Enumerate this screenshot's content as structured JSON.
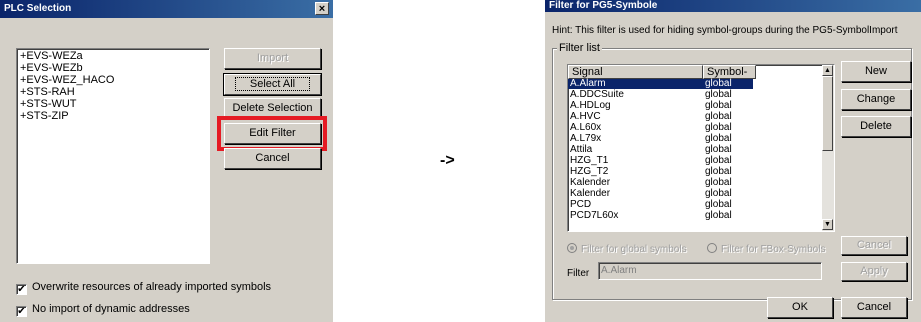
{
  "plc_dialog": {
    "title": "PLC Selection",
    "close_glyph": "×",
    "list_items": [
      "+EVS-WEZa",
      "+EVS-WEZb",
      "+EVS-WEZ_HACO",
      "+STS-RAH",
      "+STS-WUT",
      "+STS-ZIP"
    ],
    "buttons": {
      "import": "Import",
      "select_all": "Select All",
      "delete_selection": "Delete Selection",
      "edit_filter": "Edit Filter",
      "cancel": "Cancel"
    },
    "checkboxes": [
      {
        "label": "Overwrite resources of already imported symbols",
        "checked": true
      },
      {
        "label": "No import of dynamic addresses",
        "checked": true
      }
    ],
    "check_glyph": "✔"
  },
  "arrow": "->",
  "filter_dialog": {
    "title": "Filter for PG5-Symbole",
    "hint": "Hint: This filter is used for hiding symbol-groups during the PG5-SymbolImport",
    "group_label": "Filter list",
    "columns": [
      "Signal",
      "Symbol-T..."
    ],
    "rows": [
      {
        "signal": "A.Alarm",
        "type": "global"
      },
      {
        "signal": "A.DDCSuite",
        "type": "global"
      },
      {
        "signal": "A.HDLog",
        "type": "global"
      },
      {
        "signal": "A.HVC",
        "type": "global"
      },
      {
        "signal": "A.L60x",
        "type": "global"
      },
      {
        "signal": "A.L79x",
        "type": "global"
      },
      {
        "signal": "Attila",
        "type": "global"
      },
      {
        "signal": "HZG_T1",
        "type": "global"
      },
      {
        "signal": "HZG_T2",
        "type": "global"
      },
      {
        "signal": "Kalender",
        "type": "global"
      },
      {
        "signal": "Kalender",
        "type": "global"
      },
      {
        "signal": "PCD",
        "type": "global"
      },
      {
        "signal": "PCD7L60x",
        "type": "global"
      }
    ],
    "selected_row": 0,
    "buttons": {
      "new": "New",
      "change": "Change",
      "delete": "Delete",
      "cancel_inner": "Cancel",
      "apply": "Apply",
      "ok": "OK",
      "cancel": "Cancel"
    },
    "radios": [
      {
        "label": "Filter for global symbols",
        "selected": true
      },
      {
        "label": "Filter for FBox-Symbols",
        "selected": false
      }
    ],
    "filter_label": "Filter",
    "filter_value": "A.Alarm",
    "scroll_up": "▲",
    "scroll_down": "▼"
  }
}
